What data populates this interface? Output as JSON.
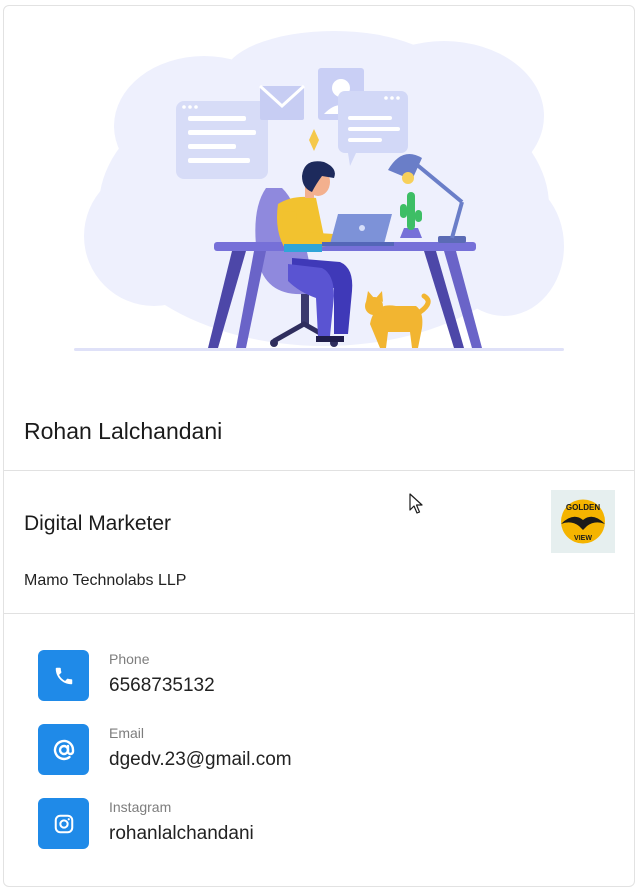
{
  "profile": {
    "name": "Rohan Lalchandani",
    "title": "Digital Marketer",
    "company": "Mamo Technolabs LLP",
    "logo_text_top": "GOLDEN",
    "logo_text_bottom": "VIEW"
  },
  "contacts": [
    {
      "label": "Phone",
      "value": "6568735132",
      "icon": "phone-icon"
    },
    {
      "label": "Email",
      "value": "dgedv.23@gmail.com",
      "icon": "at-sign-icon"
    },
    {
      "label": "Instagram",
      "value": "rohanlalchandani",
      "icon": "instagram-icon"
    }
  ],
  "colors": {
    "accent": "#1f8ae8",
    "illustration_purple": "#7b74d6",
    "illustration_yellow": "#f2b531"
  }
}
